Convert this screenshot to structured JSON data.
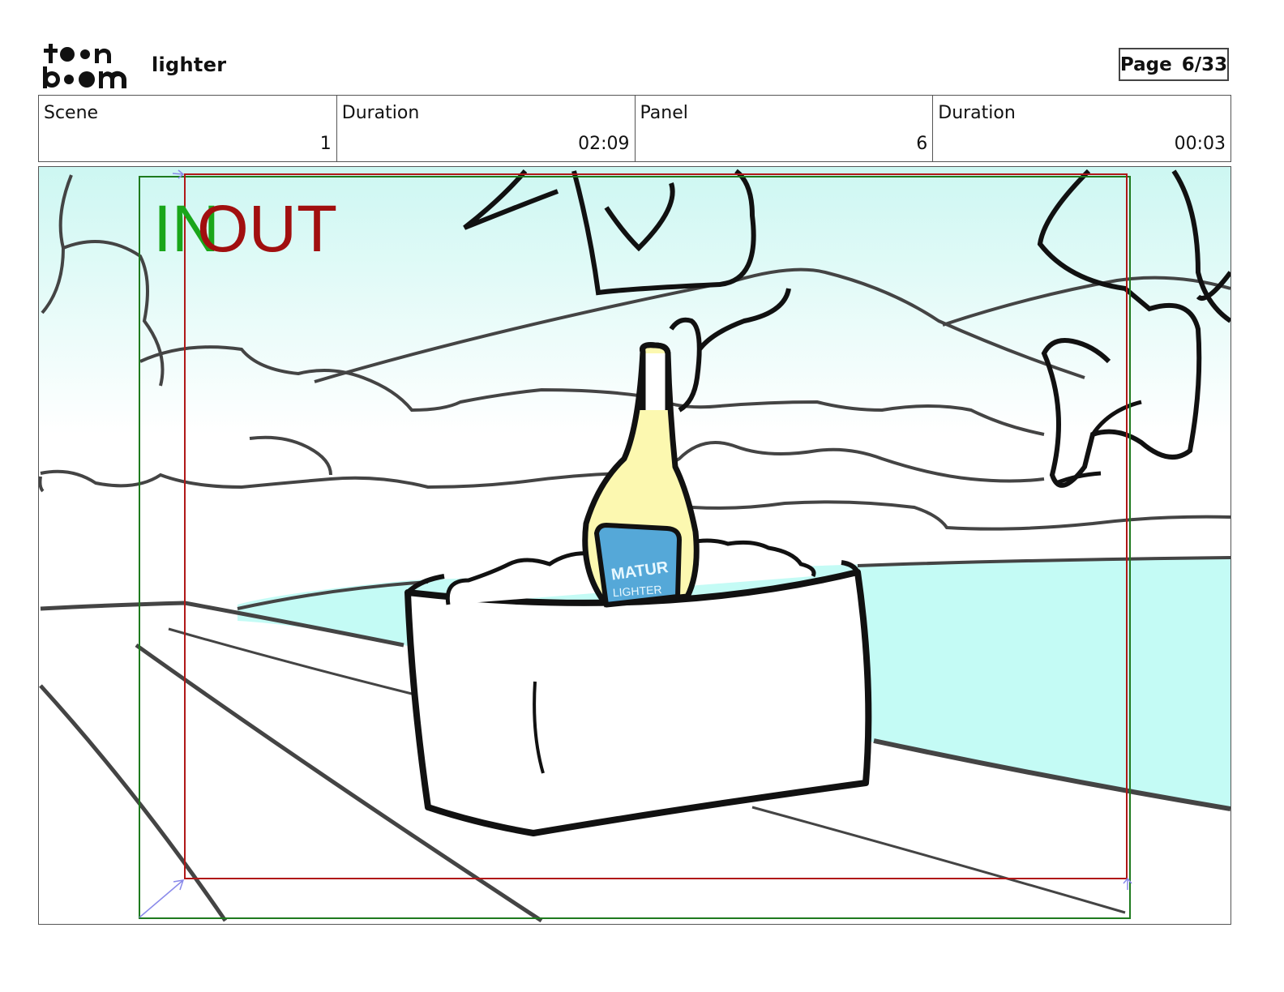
{
  "header": {
    "logo_alt": "toon boom",
    "project_title": "lighter",
    "page_label": "Page",
    "page_value": "6/33"
  },
  "info": {
    "scene_label": "Scene",
    "scene_value": "1",
    "scene_duration_label": "Duration",
    "scene_duration_value": "02:09",
    "panel_label": "Panel",
    "panel_value": "6",
    "panel_duration_label": "Duration",
    "panel_duration_value": "00:03"
  },
  "panel": {
    "in_marker": "IN",
    "out_marker": "OUT",
    "bottle_label_line1": "MATUR",
    "bottle_label_line2": "LIGHTER",
    "colors": {
      "in_frame": "#1e7a1e",
      "out_frame": "#b01818",
      "sky": "#dcf8f5",
      "pool": "#c4fbf5",
      "bottle": "#fcf8b0",
      "bottle_label": "#55a8d8"
    }
  }
}
